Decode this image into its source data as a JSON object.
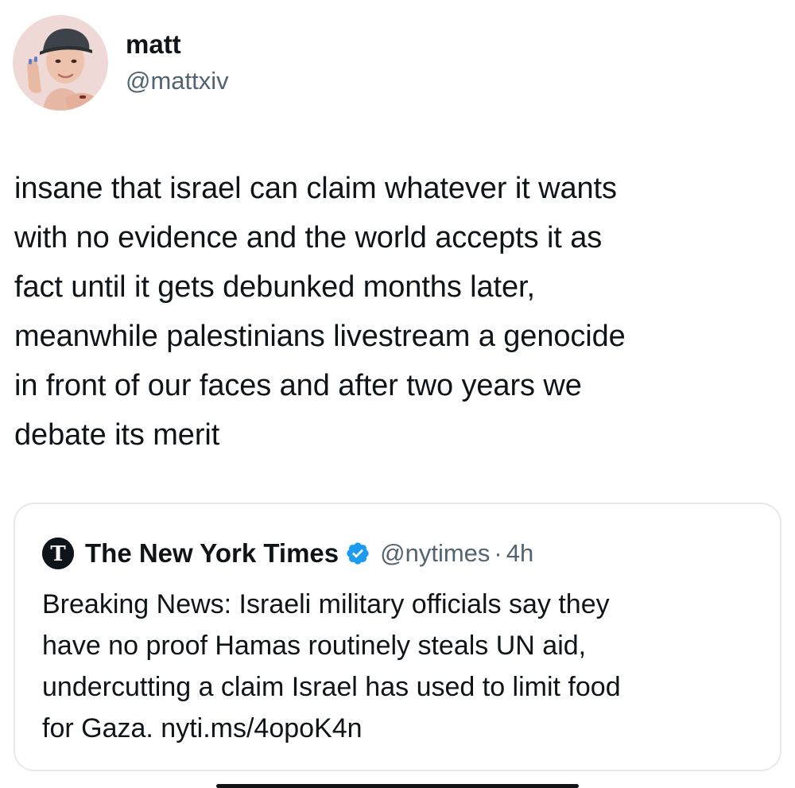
{
  "tweet": {
    "author": {
      "display_name": "matt",
      "handle": "@mattxiv",
      "avatar_icon": "profile-photo"
    },
    "text": "insane that israel can claim whatever it wants\nwith no evidence and the world accepts it as\nfact until it gets debunked months later,\nmeanwhile palestinians livestream a genocide\nin front of our faces and after two years we\ndebate its merit",
    "quoted": {
      "display_name": "The New York Times",
      "verified": true,
      "verified_color": "#1d9bf0",
      "handle": "@nytimes",
      "separator": "·",
      "time": "4h",
      "logo_icon": "nyt-logo",
      "text": "Breaking News: Israeli military officials say they\nhave no proof Hamas routinely steals UN aid,\nundercutting a claim Israel has used to limit food\nfor Gaza. nyti.ms/4opoK4n"
    }
  },
  "colors": {
    "text_primary": "#0f1419",
    "text_secondary": "#536471",
    "card_border": "#e6e9ec",
    "accent": "#1d9bf0"
  }
}
